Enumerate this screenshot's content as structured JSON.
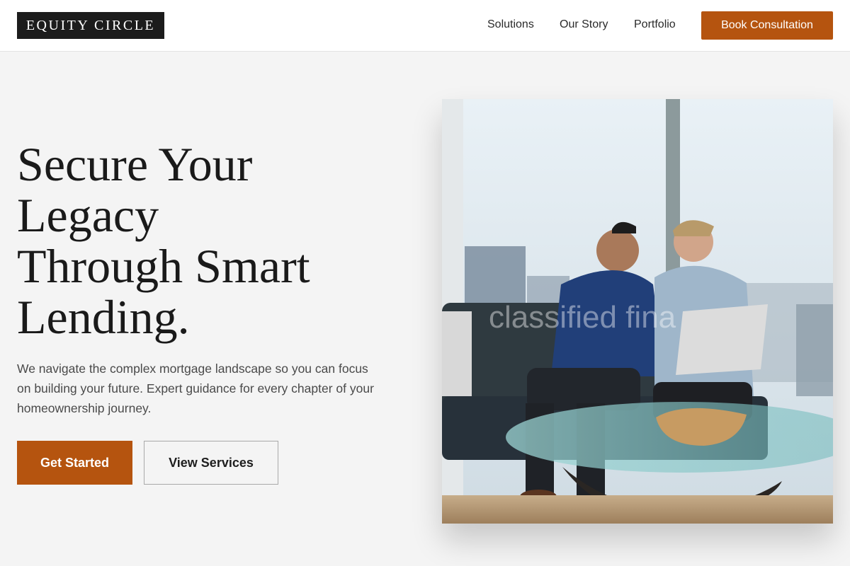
{
  "brand": {
    "name": "EQUITY CIRCLE"
  },
  "nav": {
    "items": [
      {
        "label": "Solutions"
      },
      {
        "label": "Our Story"
      },
      {
        "label": "Portfolio"
      }
    ],
    "cta_label": "Book Consultation"
  },
  "hero": {
    "title_lines": [
      "Secure Your",
      "Legacy",
      "Through Smart",
      "Lending."
    ],
    "description": "We navigate the complex mortgage landscape so you can focus on building your future. Expert guidance for every chapter of your homeownership journey.",
    "primary_button": "Get Started",
    "secondary_button": "View Services"
  },
  "photo": {
    "watermark": "classified fina"
  },
  "colors": {
    "accent": "#b5540f",
    "logo_bg": "#1c1c1c",
    "page_bg": "#f4f4f4",
    "header_bg": "#ffffff"
  }
}
